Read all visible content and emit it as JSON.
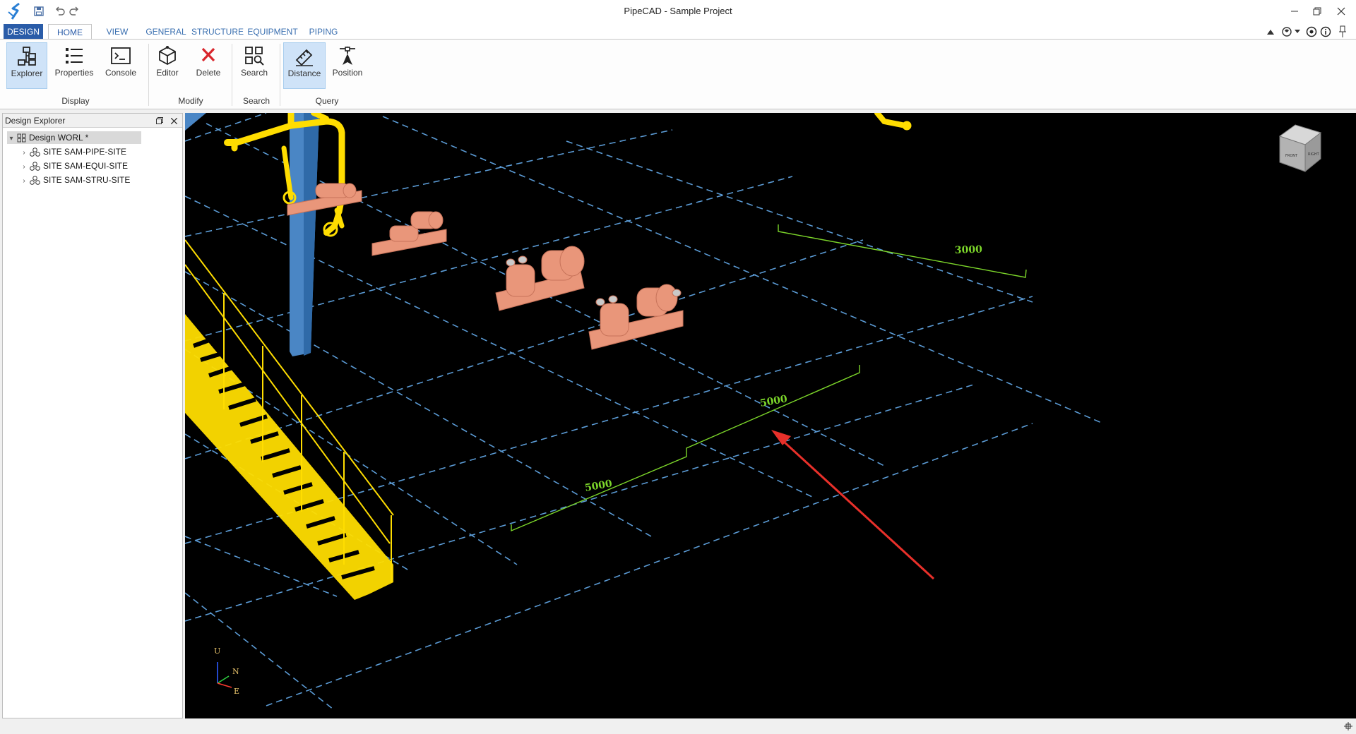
{
  "window": {
    "title": "PipeCAD - Sample Project"
  },
  "ribbon": {
    "app_tab": "DESIGN",
    "tabs": [
      "HOME",
      "VIEW",
      "GENERAL",
      "STRUCTURE",
      "EQUIPMENT",
      "PIPING"
    ],
    "active_tab": "HOME",
    "buttons": {
      "explorer": "Explorer",
      "properties": "Properties",
      "console": "Console",
      "editor": "Editor",
      "delete": "Delete",
      "search": "Search",
      "distance": "Distance",
      "position": "Position"
    },
    "groups": {
      "display": "Display",
      "modify": "Modify",
      "search": "Search",
      "query": "Query"
    }
  },
  "explorer": {
    "title": "Design Explorer",
    "root": "Design WORL *",
    "items": [
      "SITE SAM-PIPE-SITE",
      "SITE SAM-EQUI-SITE",
      "SITE SAM-STRU-SITE"
    ]
  },
  "viewport": {
    "dimensions": {
      "dim_a": "3000",
      "dim_b": "5000",
      "dim_c": "5000"
    },
    "axis": {
      "up": "U",
      "north": "N",
      "east": "E"
    }
  },
  "colors": {
    "ribbon_accent": "#2a5ca8",
    "viewport_bg": "#000000",
    "grid_line": "#5b9bd5",
    "dimension": "#7cd62a",
    "steel": "#ffdd00",
    "equipment": "#e9967a",
    "column": "#4a86c5",
    "annotation_arrow": "#e8302a"
  }
}
